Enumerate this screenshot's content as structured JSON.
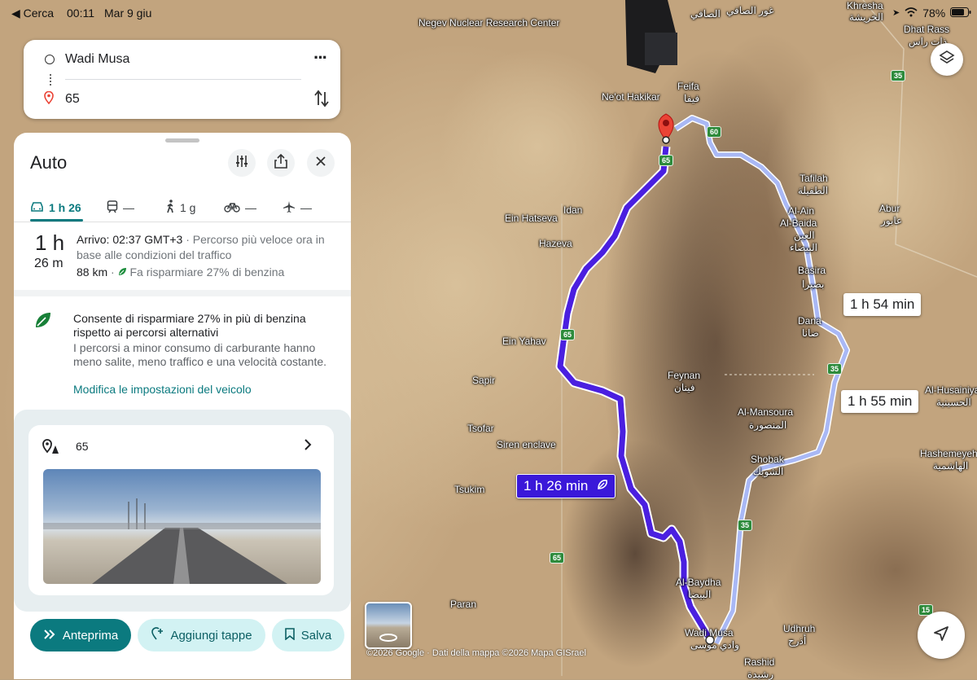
{
  "status_bar": {
    "back_label": "◀ Cerca",
    "time": "00:11",
    "date": "Mar 9 giu",
    "battery": "78%"
  },
  "search": {
    "origin": "Wadi Musa",
    "destination": "65"
  },
  "panel": {
    "title": "Auto",
    "tabs": [
      {
        "label": "1 h 26",
        "icon": "car-icon"
      },
      {
        "label": "—",
        "icon": "train-icon"
      },
      {
        "label": "1 g",
        "icon": "walk-icon"
      },
      {
        "label": "—",
        "icon": "bike-icon"
      },
      {
        "label": "—",
        "icon": "plane-icon"
      }
    ],
    "summary": {
      "hours": "1 h",
      "minutes": "26 m",
      "arrival": "Arrivo: 02:37 GMT+3",
      "description": " · Percorso più veloce ora in base alle condizioni del traffico",
      "distance": "88 km",
      "savings": "Fa risparmiare 27% di benzina"
    },
    "eco": {
      "title": "Consente di risparmiare 27% in più di benzina rispetto ai percorsi alternativi",
      "body": "I percorsi a minor consumo di carburante hanno meno salite, meno traffico e una velocità costante.",
      "link": "Modifica le impostazioni del veicolo"
    },
    "street_card": {
      "label": "65"
    },
    "actions": {
      "preview": "Anteprima",
      "add_stops": "Aggiungi tappe",
      "save": "Salva"
    }
  },
  "map": {
    "callouts": {
      "primary": "1 h 26 min",
      "alt1": "1 h 54 min",
      "alt2": "1 h 55 min"
    },
    "labels": [
      "Negev Nuclear Research Center",
      "Ne'ot Hakikar",
      "Feifa",
      "فيفا",
      "Idan",
      "Ein Hatseva",
      "Hazeva",
      "Tafilah",
      "الطفيلة",
      "Al-Ain",
      "Al-Baida",
      "العين",
      "البيضاء",
      "Basira",
      "بصيرا",
      "Dana",
      "ضانا",
      "Abur",
      "عابور",
      "Ein Yahav",
      "Sapir",
      "Feynan",
      "فينان",
      "Al-Mansoura",
      "المنصورة",
      "Tsofar",
      "Siren enclave",
      "Shobak",
      "الشوبك",
      "Tsukim",
      "Al-Husainiya",
      "الحسينية",
      "Hashemeyeh",
      "الهاشمية",
      "Al-Baydha",
      "البيضا",
      "Paran",
      "Wadi Musa",
      "وادي موسى",
      "Udhruh",
      "أذرح",
      "Rashid",
      "رشيدة",
      "Khresha",
      "الخريشة",
      "Dhat Rass",
      "ذات راس",
      "غور الصافي",
      "الصافي"
    ],
    "route_badges": [
      "60",
      "65",
      "65",
      "65",
      "35",
      "35",
      "35",
      "15"
    ],
    "attribution": "©2026 Google · Dati della mappa ©2026 Mapa GISrael"
  },
  "colors": {
    "primary_route": "#4a1fe0",
    "alt_route": "#a9b8f5",
    "teal": "#0b7a7f",
    "pill_bg": "#d2f2f3"
  }
}
